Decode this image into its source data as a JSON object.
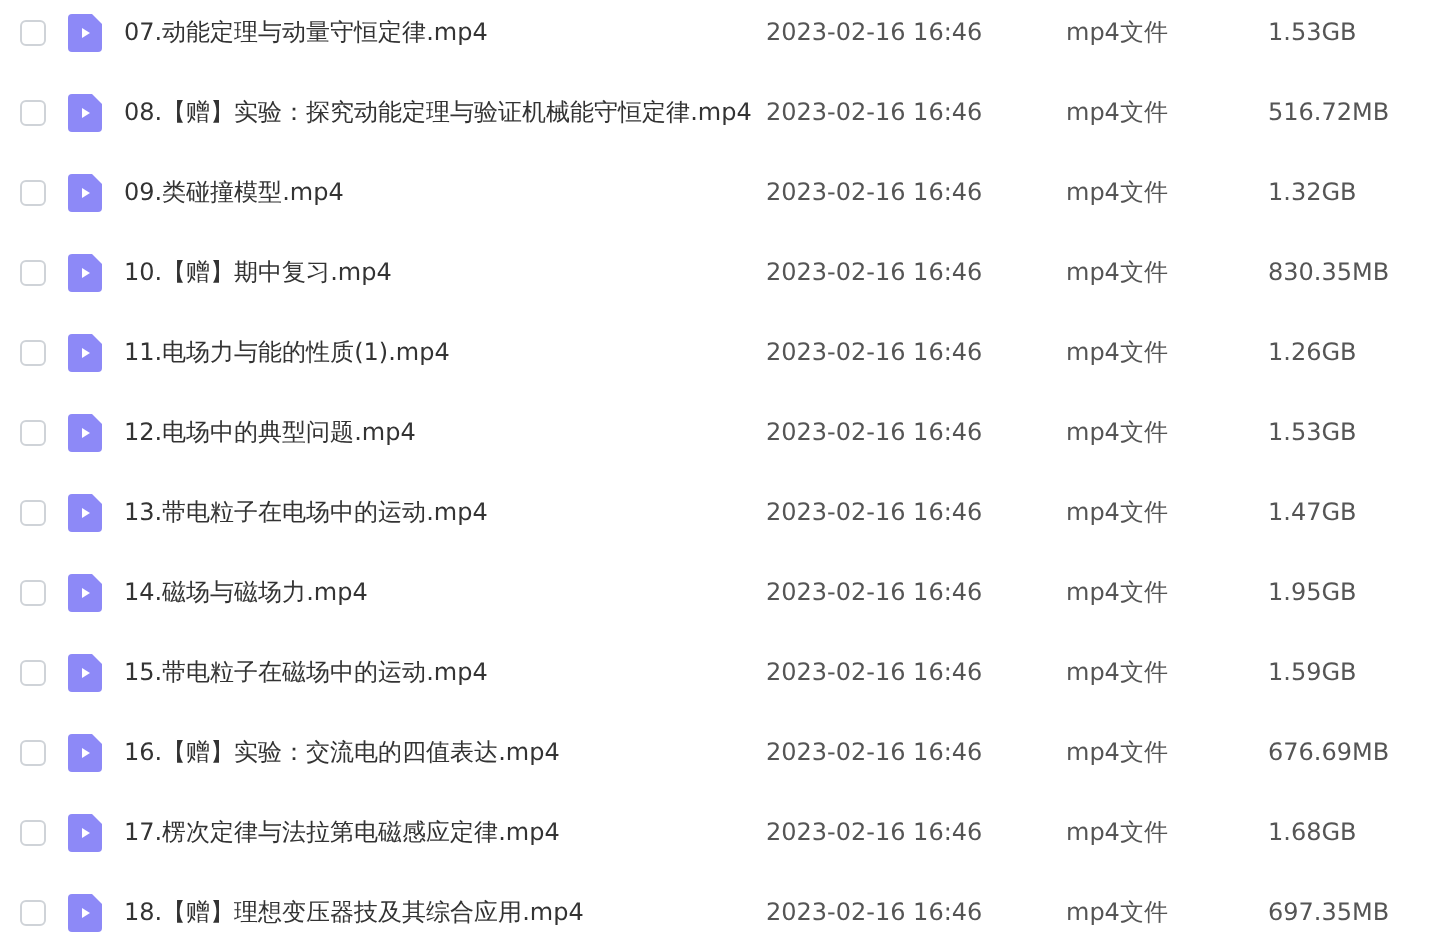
{
  "files": [
    {
      "checked": false,
      "name": "07.动能定理与动量守恒定律.mp4",
      "modified": "2023-02-16 16:46",
      "type": "mp4文件",
      "size": "1.53GB"
    },
    {
      "checked": false,
      "name": "08.【赠】实验：探究动能定理与验证机械能守恒定律.mp4",
      "modified": "2023-02-16 16:46",
      "type": "mp4文件",
      "size": "516.72MB"
    },
    {
      "checked": false,
      "name": "09.类碰撞模型.mp4",
      "modified": "2023-02-16 16:46",
      "type": "mp4文件",
      "size": "1.32GB"
    },
    {
      "checked": false,
      "name": "10.【赠】期中复习.mp4",
      "modified": "2023-02-16 16:46",
      "type": "mp4文件",
      "size": "830.35MB"
    },
    {
      "checked": false,
      "name": "11.电场力与能的性质(1).mp4",
      "modified": "2023-02-16 16:46",
      "type": "mp4文件",
      "size": "1.26GB"
    },
    {
      "checked": false,
      "name": "12.电场中的典型问题.mp4",
      "modified": "2023-02-16 16:46",
      "type": "mp4文件",
      "size": "1.53GB"
    },
    {
      "checked": false,
      "name": "13.带电粒子在电场中的运动.mp4",
      "modified": "2023-02-16 16:46",
      "type": "mp4文件",
      "size": "1.47GB"
    },
    {
      "checked": false,
      "name": "14.磁场与磁场力.mp4",
      "modified": "2023-02-16 16:46",
      "type": "mp4文件",
      "size": "1.95GB"
    },
    {
      "checked": false,
      "name": "15.带电粒子在磁场中的运动.mp4",
      "modified": "2023-02-16 16:46",
      "type": "mp4文件",
      "size": "1.59GB"
    },
    {
      "checked": false,
      "name": "16.【赠】实验：交流电的四值表达.mp4",
      "modified": "2023-02-16 16:46",
      "type": "mp4文件",
      "size": "676.69MB"
    },
    {
      "checked": false,
      "name": "17.楞次定律与法拉第电磁感应定律.mp4",
      "modified": "2023-02-16 16:46",
      "type": "mp4文件",
      "size": "1.68GB"
    },
    {
      "checked": false,
      "name": "18.【赠】理想变压器技及其综合应用.mp4",
      "modified": "2023-02-16 16:46",
      "type": "mp4文件",
      "size": "697.35MB"
    }
  ]
}
